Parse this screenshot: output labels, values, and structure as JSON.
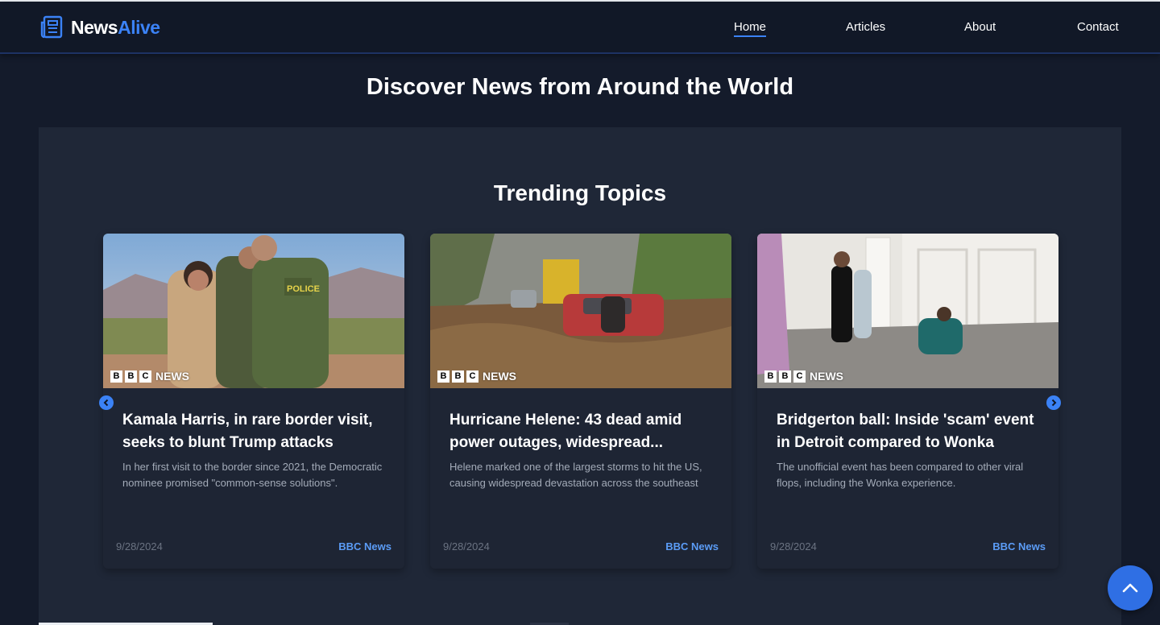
{
  "brand": {
    "name_part1": "News",
    "name_part2": "Alive",
    "icon": "newspaper-icon"
  },
  "nav": {
    "items": [
      {
        "label": "Home",
        "active": true
      },
      {
        "label": "Articles",
        "active": false
      },
      {
        "label": "About",
        "active": false
      },
      {
        "label": "Contact",
        "active": false
      }
    ]
  },
  "page": {
    "title": "Discover News from Around the World"
  },
  "trending": {
    "title": "Trending Topics",
    "cards": [
      {
        "title": "Kamala Harris, in rare border visit, seeks to blunt Trump attacks",
        "description": "In her first visit to the border since 2021, the Democratic nominee promised \"common-sense solutions\".",
        "date": "9/28/2024",
        "source": "BBC News",
        "image_badge": "NEWS"
      },
      {
        "title": "Hurricane Helene: 43 dead amid power outages, widespread...",
        "description": "Helene marked one of the largest storms to hit the US, causing widespread devastation across the southeast",
        "date": "9/28/2024",
        "source": "BBC News",
        "image_badge": "NEWS"
      },
      {
        "title": "Bridgerton ball: Inside 'scam' event in Detroit compared to Wonka",
        "description": "The unofficial event has been compared to other viral flops, including the Wonka experience.",
        "date": "9/28/2024",
        "source": "BBC News",
        "image_badge": "NEWS"
      }
    ],
    "badge_letters": [
      "B",
      "B",
      "C"
    ]
  },
  "colors": {
    "background": "#141b2b",
    "navbar": "#111827",
    "panel": "#1f2737",
    "accent": "#3b82f6",
    "source_link": "#5b9cf6"
  },
  "icons": {
    "carousel_prev": "chevron-left-icon",
    "carousel_next": "chevron-right-icon",
    "scroll_top": "chevron-up-icon"
  }
}
